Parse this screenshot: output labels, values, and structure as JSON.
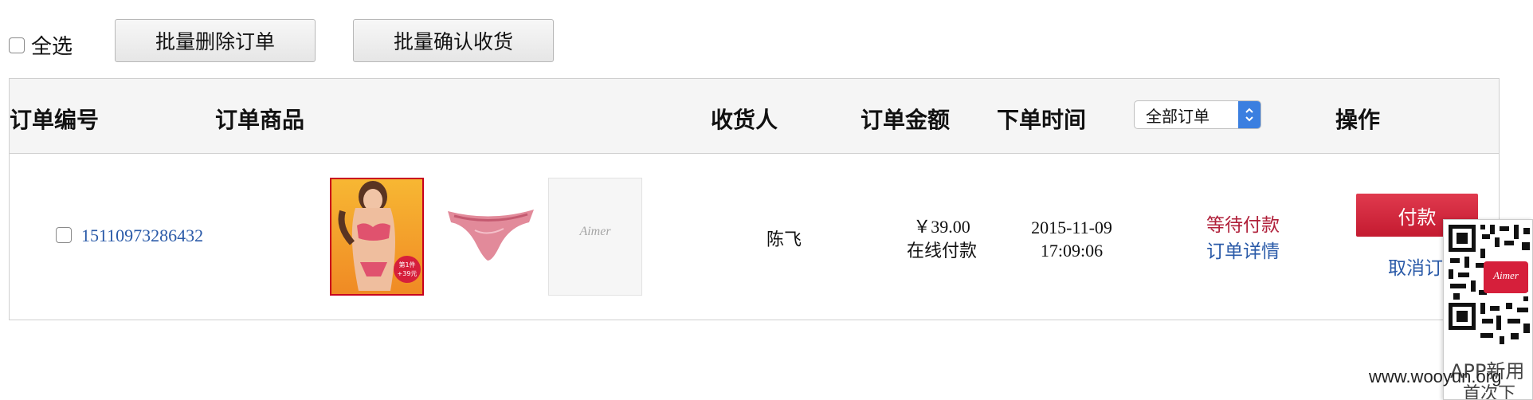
{
  "toolbar": {
    "select_all_label": "全选",
    "batch_delete_label": "批量删除订单",
    "batch_confirm_label": "批量确认收货"
  },
  "table": {
    "headers": {
      "order_no": "订单编号",
      "goods": "订单商品",
      "consignee": "收货人",
      "amount": "订单金额",
      "order_time": "下单时间",
      "actions": "操作"
    },
    "filter": {
      "selected": "全部订单"
    },
    "rows": [
      {
        "order_no": "15110973286432",
        "consignee": "陈飞",
        "price": "￥39.00",
        "payment_method": "在线付款",
        "date": "2015-11-09",
        "time": "17:09:06",
        "status": "等待付款",
        "detail_link": "订单详情",
        "pay_label": "付款",
        "cancel_label": "取消订单",
        "product_badge_line1": "第1件",
        "product_badge_line2": "+39元",
        "brand_logo_text": "Aimer"
      }
    ]
  },
  "qr_widget": {
    "brand_text": "Aimer",
    "caption": "APP新用",
    "caption2": "首次下"
  },
  "watermark": "www.wooyun.org",
  "colors": {
    "link_blue": "#2a5aa8",
    "status_red": "#b0203a",
    "pay_button_red": "#d42a3e",
    "select_arrow_blue": "#3b7fe0",
    "header_bg": "#f5f5f5"
  }
}
